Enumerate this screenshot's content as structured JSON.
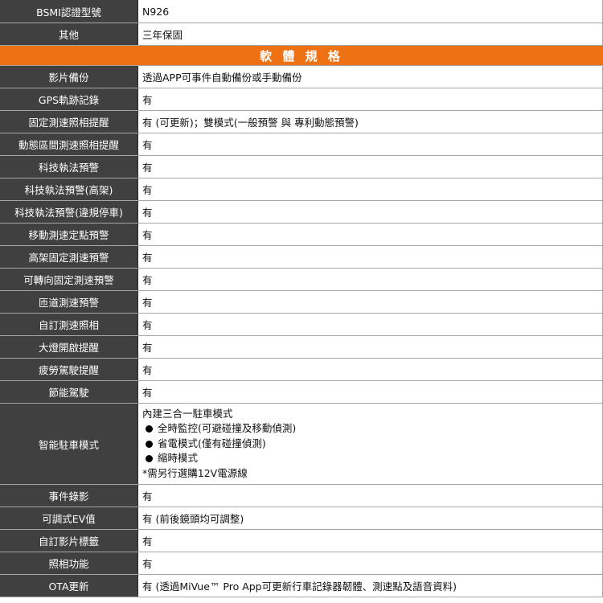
{
  "colors": {
    "label_bg": "#404040",
    "header_bg": "#ee7113",
    "border": "#a6a6a6"
  },
  "top_rows": [
    {
      "label": "BSMI認證型號",
      "value": "N926"
    },
    {
      "label": "其他",
      "value": "三年保固"
    }
  ],
  "section_header": "軟 體 規 格",
  "rows": [
    {
      "label": "影片備份",
      "value": "透過APP可事件自動備份或手動備份"
    },
    {
      "label": "GPS軌跡記錄",
      "value": "有"
    },
    {
      "label": "固定測速照相提醒",
      "value": "有 (可更新)；雙模式(一般預警 與 專利動態預警)"
    },
    {
      "label": "動態區間測速照相提醒",
      "value": "有"
    },
    {
      "label": "科技執法預警",
      "value": "有"
    },
    {
      "label": "科技執法預警(高架)",
      "value": "有"
    },
    {
      "label": "科技執法預警(違規停車)",
      "value": "有"
    },
    {
      "label": "移動測速定點預警",
      "value": "有"
    },
    {
      "label": "高架固定測速預警",
      "value": "有"
    },
    {
      "label": "可轉向固定測速預警",
      "value": "有"
    },
    {
      "label": "匝道測速預警",
      "value": "有"
    },
    {
      "label": "自訂測速照相",
      "value": "有"
    },
    {
      "label": "大燈開啟提醒",
      "value": "有"
    },
    {
      "label": "疲勞駕駛提醒",
      "value": "有"
    },
    {
      "label": "節能駕駛",
      "value": "有"
    }
  ],
  "parking": {
    "label": "智能駐車模式",
    "intro": "內建三合一駐車模式",
    "bullets": [
      "全時監控(可避碰撞及移動偵測)",
      "省電模式(僅有碰撞偵測)",
      "縮時模式"
    ],
    "note": "*需另行選購12V電源線"
  },
  "bottom_rows": [
    {
      "label": "事件錄影",
      "value": "有"
    },
    {
      "label": "可調式EV值",
      "value": "有 (前後鏡頭均可調整)"
    },
    {
      "label": "自訂影片標籤",
      "value": "有"
    },
    {
      "label": "照相功能",
      "value": "有"
    },
    {
      "label": "OTA更新",
      "value": "有 (透過MiVue™ Pro App可更新行車記錄器韌體、測速點及語音資料)"
    }
  ]
}
